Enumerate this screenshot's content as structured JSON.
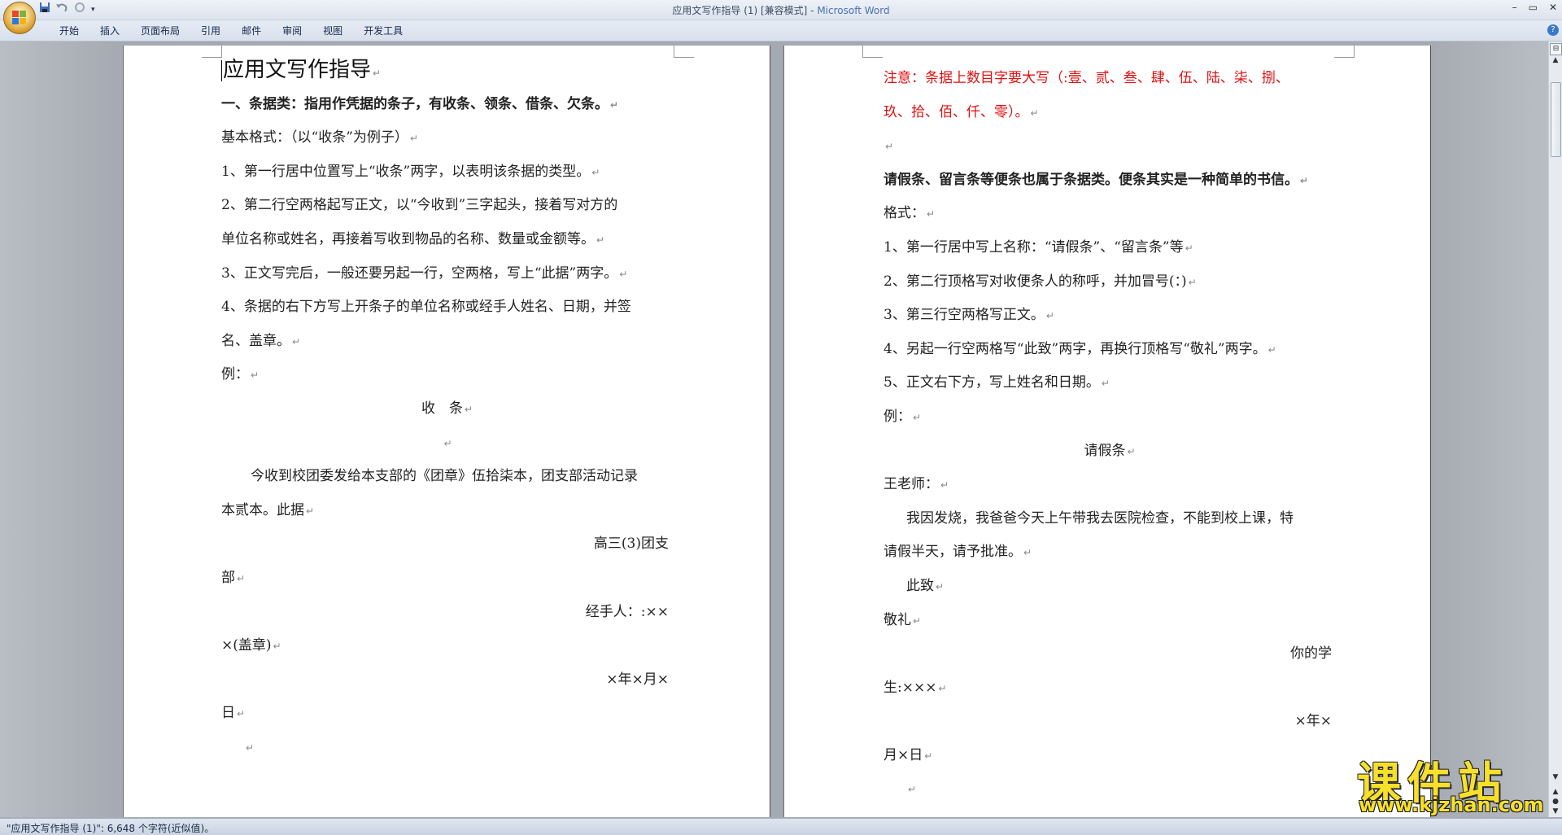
{
  "window": {
    "title_doc": "应用文写作指导 (1) [兼容模式] - ",
    "title_app": "Microsoft Word",
    "min": "–",
    "max": "▭",
    "close": "✕"
  },
  "quick_access": {
    "save_icon": "save-icon",
    "undo_icon": "undo-icon",
    "redo_icon": "redo-icon",
    "customize_icon": "dropdown-arrow-icon"
  },
  "ribbon": {
    "tabs": [
      "开始",
      "插入",
      "页面布局",
      "引用",
      "邮件",
      "审阅",
      "视图",
      "开发工具"
    ],
    "help": "?"
  },
  "page1": {
    "lines": [
      "应用文写作指导",
      "一、条据类：指用作凭据的条子，有收条、领条、借条、欠条。",
      "基本格式：（以“收条”为例子）",
      "1、第一行居中位置写上“收条”两字，以表明该条据的类型。",
      "2、第二行空两格起写正文，以“今收到”三字起头，接着写对方的",
      "单位名称或姓名，再接着写收到物品的名称、数量或金额等。",
      "3、正文写完后，一般还要另起一行，空两格，写上“此据”两字。",
      "4、条据的右下方写上开条子的单位名称或经手人姓名、日期，并签",
      "名、盖章。",
      "例：",
      "收　条",
      "",
      "今收到校团委发给本支部的《团章》伍拾柒本，团支部活动记录",
      "本贰本。此据",
      "高三(3)团支",
      "部",
      "经手人：:××",
      "×(盖章)",
      "×年×月×",
      "日",
      ""
    ]
  },
  "page2": {
    "lines": [
      "注意：条据上数目字要大写（:壹、贰、叁、肆、伍、陆、柒、捌、",
      "玖、拾、佰、仟、零）。",
      "",
      "请假条、留言条等便条也属于条据类。便条其实是一种简单的书信。",
      "格式：",
      "1、第一行居中写上名称：“请假条”、“留言条”等",
      "2、第二行顶格写对收便条人的称呼，并加冒号(：)",
      "3、第三行空两格写正文。",
      "4、另起一行空两格写“此致”两字，再换行顶格写“敬礼”两字。",
      "5、正文右下方，写上姓名和日期。",
      "例：",
      "请假条",
      "王老师：",
      "我因发烧，我爸爸今天上午带我去医院检查，不能到校上课，特",
      "请假半天，请予批准。",
      "此致",
      "敬礼",
      "你的学",
      "生:×××",
      "×年×",
      "月×日",
      ""
    ]
  },
  "status": {
    "text": "\"应用文写作指导 (1)\": 6,648 个字符(近似值)。"
  },
  "watermark": {
    "main": "课件站",
    "url": "www.kjzhan.com"
  },
  "colors": {
    "red_text": "#e01010",
    "accent_blue": "#4a6fb0"
  }
}
